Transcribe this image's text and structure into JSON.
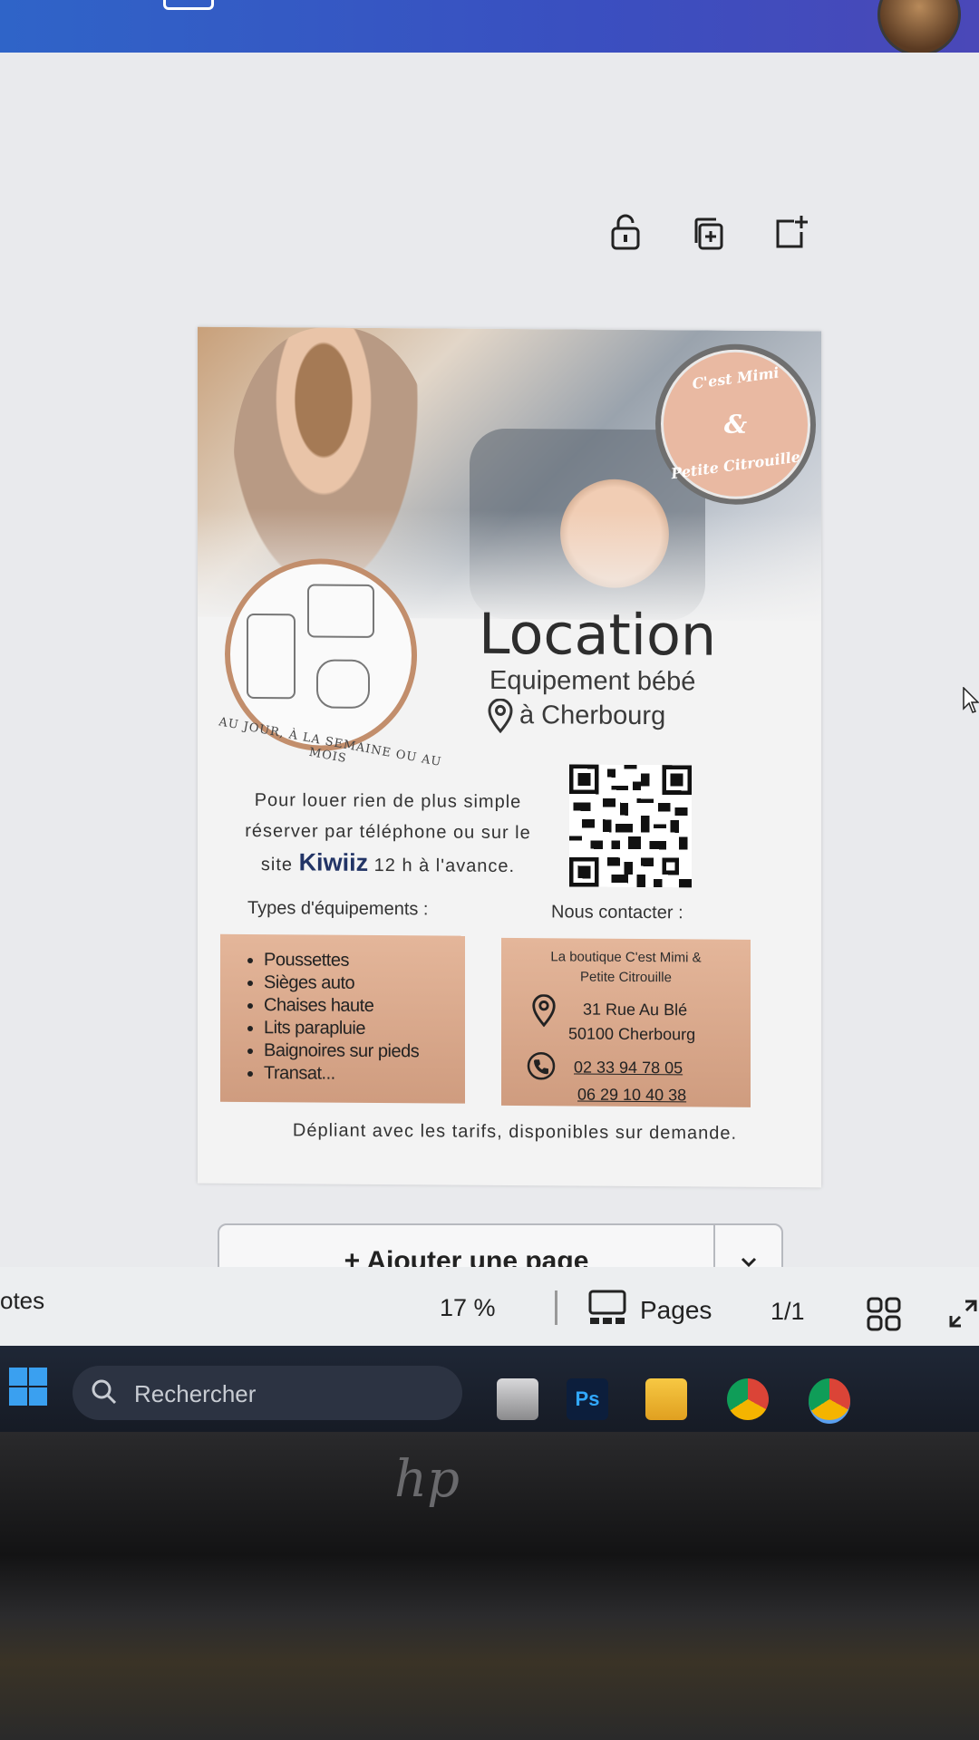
{
  "editor": {
    "toolbar": {
      "lock_icon": "lock-open-icon",
      "duplicate_icon": "duplicate-page-icon",
      "add_icon": "add-page-icon"
    },
    "add_page": {
      "label": "+ Ajouter une page"
    },
    "status_bar": {
      "notes_label": "otes",
      "zoom": "17 %",
      "pages_label": "Pages",
      "page_count": "1/1"
    }
  },
  "poster": {
    "logo": {
      "top": "C'est Mimi",
      "amp": "&",
      "bottom": "Petite Citrouille"
    },
    "circle_caption": "AU JOUR, À LA SEMAINE OU AU MOIS",
    "title": "Location",
    "subtitle": "Equipement bébé",
    "city": "à Cherbourg",
    "intro_line1": "Pour louer rien de plus simple",
    "intro_line2": "réserver par téléphone ou sur le",
    "intro_site": "site",
    "intro_brand": "Kiwiiz",
    "intro_end": "12 h à l'avance.",
    "types_label": "Types d'équipements :",
    "contact_label": "Nous contacter :",
    "equipment": [
      "Poussettes",
      "Sièges auto",
      "Chaises haute",
      "Lits parapluie",
      "Baignoires sur pieds",
      "Transat..."
    ],
    "contact": {
      "shop_line1": "La boutique C'est Mimi &",
      "shop_line2": "Petite Citrouille",
      "address1": "31 Rue Au Blé",
      "address2": "50100 Cherbourg",
      "phone1": "02 33 94 78 05",
      "phone2": "06 29 10 40 38"
    },
    "flyer_note": "Dépliant avec les tarifs, disponibles sur demande."
  },
  "taskbar": {
    "search_placeholder": "Rechercher",
    "apps": [
      "file-explorer-icon",
      "photoshop-icon",
      "folder-icon",
      "chrome-icon",
      "chrome-profile-icon"
    ]
  },
  "device": {
    "brand": "hp"
  },
  "colors": {
    "title_bar": "#2f64c8",
    "poster_accent": "#cf9c7f",
    "logo_bg": "#e9b9a2"
  }
}
